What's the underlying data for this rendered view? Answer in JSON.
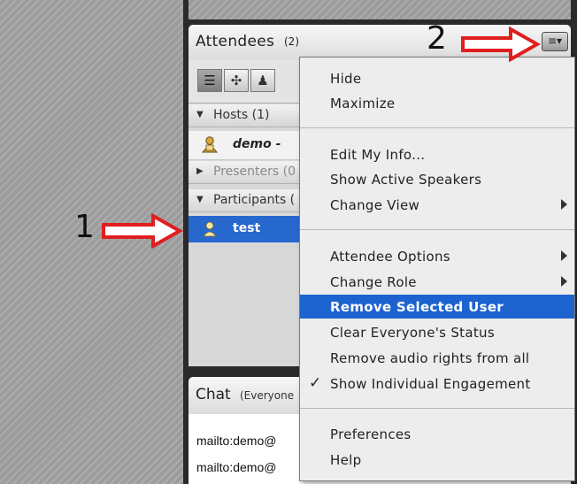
{
  "attendees_pod": {
    "title": "Attendees",
    "count": "(2)",
    "options_button_glyph": "≡▾",
    "toolbar": [
      {
        "name": "list-view-icon",
        "glyph": "☰",
        "active": true
      },
      {
        "name": "fullscreen-view-icon",
        "glyph": "✣",
        "active": false
      },
      {
        "name": "attendee-status-view-icon",
        "glyph": "♟",
        "active": false
      }
    ],
    "hosts_label": "Hosts (1)",
    "host_name": "demo -",
    "presenters_label": "Presenters (0",
    "participants_label": "Participants (",
    "participant_name": "test"
  },
  "chat_pod": {
    "title": "Chat",
    "subtitle": "(Everyone",
    "lines": [
      "mailto:demo@",
      "mailto:demo@"
    ]
  },
  "menu": {
    "groups": [
      [
        {
          "label": "Hide",
          "submenu": false
        },
        {
          "label": "Maximize",
          "submenu": false
        }
      ],
      [
        {
          "label": "Edit My Info...",
          "submenu": false
        },
        {
          "label": "Show Active Speakers",
          "submenu": false
        },
        {
          "label": "Change View",
          "submenu": true
        }
      ],
      [
        {
          "label": "Attendee Options",
          "submenu": true
        },
        {
          "label": "Change Role",
          "submenu": true
        },
        {
          "label": "Remove Selected User",
          "submenu": false,
          "highlighted": true
        },
        {
          "label": "Clear Everyone's Status",
          "submenu": false
        },
        {
          "label": "Remove audio rights from all",
          "submenu": false
        },
        {
          "label": "Show Individual Engagement",
          "submenu": false,
          "checked": true
        }
      ],
      [
        {
          "label": "Preferences",
          "submenu": false
        },
        {
          "label": "Help",
          "submenu": false
        }
      ]
    ],
    "check_glyph": "✓"
  },
  "annotations": {
    "marker_1": "1",
    "marker_2": "2",
    "arrow_color": "#e01e1e"
  },
  "colors": {
    "selection_blue": "#2768cf",
    "menu_highlight": "#1d63cf"
  }
}
